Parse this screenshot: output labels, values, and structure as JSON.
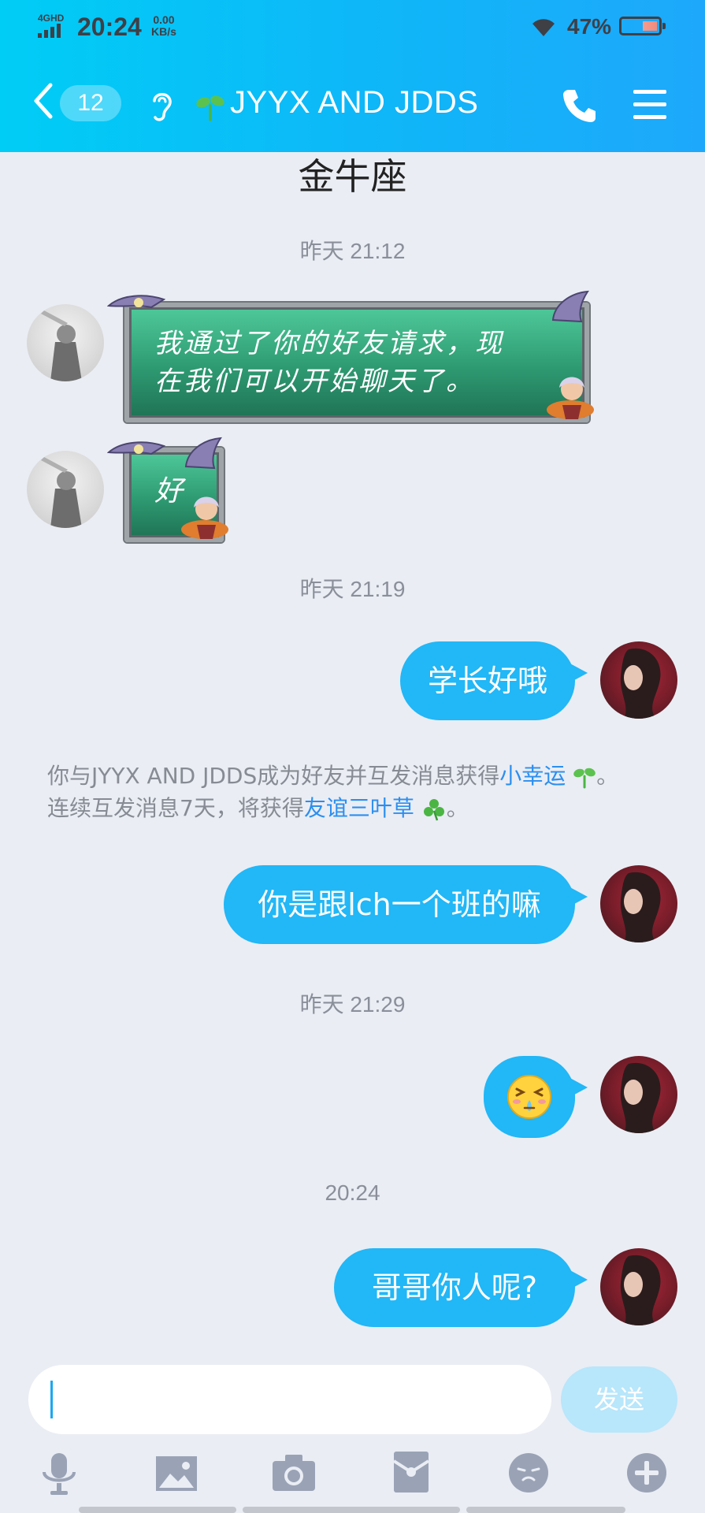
{
  "status_bar": {
    "network": "4GHD",
    "time": "20:24",
    "speed_value": "0.00",
    "speed_unit": "KB/s",
    "battery": "47%"
  },
  "header": {
    "unread_count": "12",
    "title": "JYYX AND JDDS"
  },
  "conversation": {
    "partial_top_text": "金牛座",
    "timestamps": [
      "昨天 21:12",
      "昨天 21:19",
      "昨天 21:29",
      "20:24"
    ],
    "received_1_line1": "我通过了你的好友请求，现",
    "received_1_line2": "在我们可以开始聊天了。",
    "received_2": "好",
    "sent_1": "学长好哦",
    "sent_2": "你是跟lch一个班的嘛",
    "sent_4": "哥哥你人呢?"
  },
  "system_message": {
    "line1_prefix": "你与JYYX AND JDDS成为好友并互发消息获得",
    "line1_link": "小幸运",
    "line1_suffix": "。",
    "line2_prefix": "连续互发消息7天，将获得",
    "line2_link": "友谊三叶草",
    "line2_suffix": "。"
  },
  "input_bar": {
    "send_label": "发送"
  },
  "colors": {
    "header_start": "#00cdf6",
    "header_end": "#1ea8fb",
    "bubble_blue": "#22b7f6",
    "link_blue": "#2b8ff0",
    "background": "#eaedf4"
  }
}
